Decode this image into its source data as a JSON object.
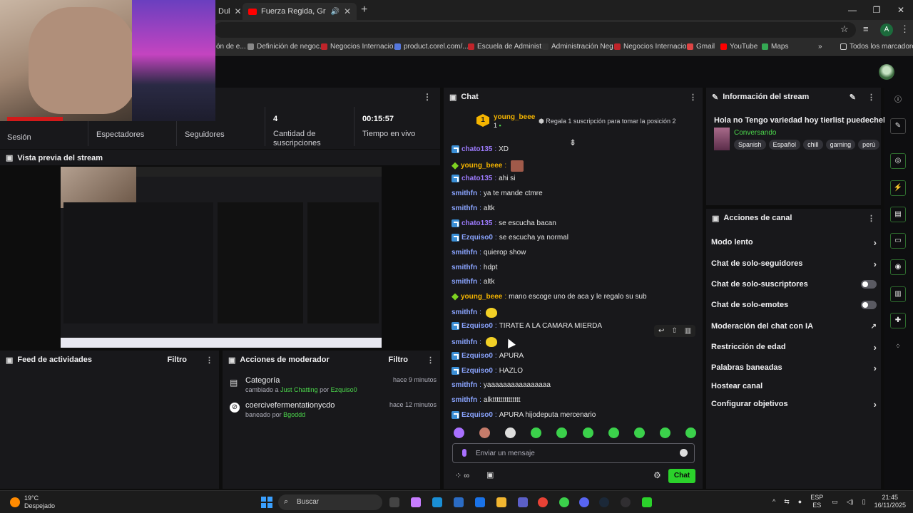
{
  "browser": {
    "tabs": [
      {
        "title": "Dul"
      },
      {
        "title": "Fuerza Regida, Grupo Fronte"
      }
    ],
    "new_tab": "+",
    "window": {
      "minimize": "—",
      "restore": "❐",
      "close": "✕"
    },
    "profile_initial": "A",
    "bookmarks": [
      {
        "label": "ón de e..."
      },
      {
        "label": "Definición de negoc..."
      },
      {
        "label": "Negocios Internacio..."
      },
      {
        "label": "product.corel.com/..."
      },
      {
        "label": "Escuela de Administ..."
      },
      {
        "label": "Administración Neg..."
      },
      {
        "label": "Negocios Internacio..."
      },
      {
        "label": "Gmail"
      },
      {
        "label": "YouTube"
      },
      {
        "label": "Maps"
      }
    ],
    "bookmarks_more": "»",
    "all_bookmarks": "Todos los marcadores"
  },
  "stats": {
    "session_label": "Sesión",
    "viewers_label": "Espectadores",
    "followers_label": "Seguidores",
    "subs_value": "4",
    "subs_label": "Cantidad de suscripciones",
    "live_value": "00:15:57",
    "live_label": "Tiempo en vivo"
  },
  "preview": {
    "title": "Vista previa del stream"
  },
  "feed": {
    "title": "Feed de actividades",
    "filter": "Filtro"
  },
  "moderator": {
    "title": "Acciones de moderador",
    "filter": "Filtro",
    "items": [
      {
        "title": "Categoría",
        "action": "cambiado a",
        "target": "Just Chatting",
        "by": "por",
        "user": "Ezquiso0",
        "time": "hace 9 minutos"
      },
      {
        "title": "coercivefermentationycdo",
        "action": "baneado",
        "by": "por",
        "user": "Bgoddd",
        "time": "hace 12 minutos"
      }
    ]
  },
  "chat": {
    "title": "Chat",
    "pinned": {
      "rank": "1",
      "user": "young_beee",
      "count": "1",
      "text": "Regala 1 suscripción para tomar la posición 2"
    },
    "messages": [
      {
        "user": "chato135",
        "text": "XD",
        "color": "#9d7bff",
        "badge": "sub"
      },
      {
        "user": "young_beee",
        "text": "",
        "color": "#f4b400",
        "badge": "gift",
        "emote": "face"
      },
      {
        "user": "chato135",
        "text": "ahi si",
        "color": "#9d7bff",
        "badge": "sub"
      },
      {
        "user": "smithfn",
        "text": "ya te mande ctmre",
        "color": "#8aa4ff",
        "badge": ""
      },
      {
        "user": "smithfn",
        "text": "altk",
        "color": "#8aa4ff",
        "badge": ""
      },
      {
        "user": "chato135",
        "text": "se escucha bacan",
        "color": "#9d7bff",
        "badge": "sub"
      },
      {
        "user": "Ezquiso0",
        "text": "se escucha ya normal",
        "color": "#8aa4ff",
        "badge": "sub"
      },
      {
        "user": "smithfn",
        "text": "quierop show",
        "color": "#8aa4ff",
        "badge": ""
      },
      {
        "user": "smithfn",
        "text": "hdpt",
        "color": "#8aa4ff",
        "badge": ""
      },
      {
        "user": "smithfn",
        "text": "altk",
        "color": "#8aa4ff",
        "badge": ""
      },
      {
        "user": "young_beee",
        "text": "mano escoge uno de aca y le regalo su sub",
        "color": "#f4b400",
        "badge": "gift"
      },
      {
        "user": "smithfn",
        "text": "",
        "color": "#8aa4ff",
        "badge": "",
        "emote": "yellow"
      },
      {
        "user": "Ezquiso0",
        "text": "TIRATE A LA CAMARA MIERDA",
        "color": "#8aa4ff",
        "badge": "sub"
      },
      {
        "user": "smithfn",
        "text": "",
        "color": "#8aa4ff",
        "badge": "",
        "emote": "yellow"
      },
      {
        "user": "Ezquiso0",
        "text": "APURA",
        "color": "#8aa4ff",
        "badge": "sub"
      },
      {
        "user": "Ezquiso0",
        "text": "HAZLO",
        "color": "#8aa4ff",
        "badge": "sub"
      },
      {
        "user": "smithfn",
        "text": "yaaaaaaaaaaaaaaaa",
        "color": "#8aa4ff",
        "badge": ""
      },
      {
        "user": "smithfn",
        "text": "alktttttttttttttt",
        "color": "#8aa4ff",
        "badge": ""
      },
      {
        "user": "Ezquiso0",
        "text": "APURA hijodeputa mercenario",
        "color": "#8aa4ff",
        "badge": "sub"
      }
    ],
    "input_placeholder": "Enviar un mensaje",
    "points": "∞",
    "send": "Chat"
  },
  "info": {
    "title": "Información del stream",
    "stream_title": "Hola no Tengo variedad hoy tierlist puedechel",
    "category": "Conversando",
    "tags": [
      "Spanish",
      "Español",
      "chill",
      "gaming",
      "perú"
    ]
  },
  "channel": {
    "title": "Acciones de canal",
    "rows": [
      {
        "label": "Modo lento",
        "control": "chevron"
      },
      {
        "label": "Chat de solo-seguidores",
        "control": "chevron"
      },
      {
        "label": "Chat de solo-suscriptores",
        "control": "toggle"
      },
      {
        "label": "Chat de solo-emotes",
        "control": "toggle"
      },
      {
        "label": "Moderación del chat con IA",
        "control": "external"
      },
      {
        "label": "Restricción de edad",
        "control": "chevron"
      },
      {
        "label": "Palabras baneadas",
        "control": "chevron"
      },
      {
        "label": "Hostear canal",
        "control": "none"
      },
      {
        "label": "Configurar objetivos",
        "control": "chevron"
      }
    ]
  },
  "taskbar": {
    "temp": "19°C",
    "weather": "Despejado",
    "search": "Buscar",
    "lang1": "ESP",
    "lang2": "ES",
    "time": "21:45",
    "date": "16/11/2025"
  },
  "colors": {
    "accent": "#2bd22b",
    "chat_bg": "#18181b",
    "app_bg": "#0d0d0d"
  }
}
